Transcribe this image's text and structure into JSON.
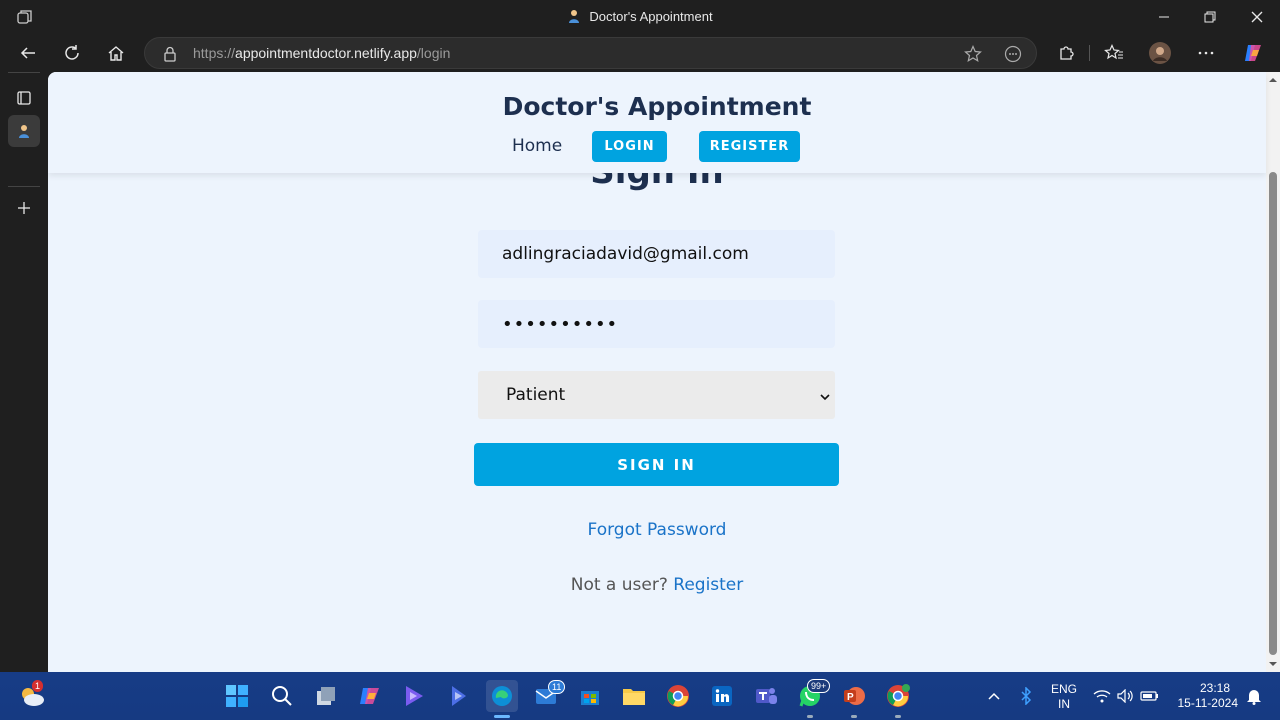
{
  "window": {
    "title": "Doctor's Appointment"
  },
  "browser": {
    "url_scheme": "https://",
    "url_host": "appointmentdoctor.netlify.app",
    "url_path": "/login"
  },
  "site": {
    "title": "Doctor's Appointment",
    "nav": {
      "home": "Home",
      "login": "LOGIN",
      "register": "REGISTER"
    }
  },
  "form": {
    "heading": "Sign In",
    "email_value": "adlingraciadavid@gmail.com",
    "password_masked": "••••••••••",
    "role_selected": "Patient",
    "submit_label": "SIGN IN",
    "forgot_label": "Forgot Password",
    "not_user_text": "Not a user?",
    "register_link": "Register"
  },
  "taskbar": {
    "weather_badge": "1",
    "mail_badge": "11",
    "whatsapp_badge": "99+",
    "language_line1": "ENG",
    "language_line2": "IN",
    "time": "23:18",
    "date": "15-11-2024"
  },
  "colors": {
    "accent": "#00a3e0",
    "title": "#1d2f4f",
    "page_bg": "#edf4fd",
    "link": "#1a73c8"
  }
}
